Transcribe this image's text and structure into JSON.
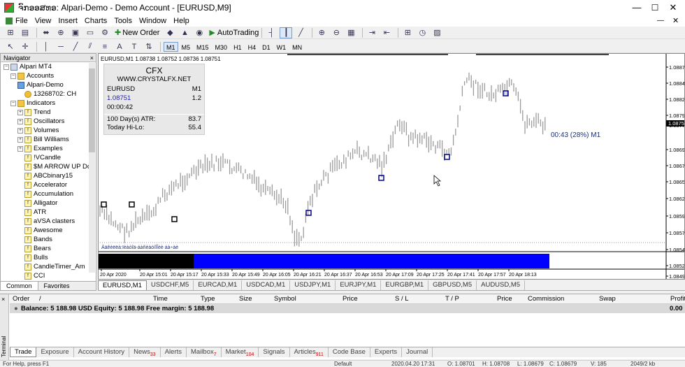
{
  "window": {
    "title": "ຈົກອອສທອ: Alpari-Demo - Demo Account - [EURUSD,M9]",
    "minimize": "—",
    "maximize": "☐",
    "close": "✕"
  },
  "menu": [
    "File",
    "View",
    "Insert",
    "Charts",
    "Tools",
    "Window",
    "Help"
  ],
  "toolbar": {
    "new_order": "New Order",
    "autotrading": "AutoTrading",
    "timeframes": [
      "M1",
      "M5",
      "M15",
      "M30",
      "H1",
      "H4",
      "D1",
      "W1",
      "MN"
    ]
  },
  "navigator": {
    "title": "Navigator",
    "close": "×",
    "items": [
      {
        "label": "Alpari MT4",
        "level": 0,
        "kind": "root"
      },
      {
        "label": "Accounts",
        "level": 1,
        "kind": "folder"
      },
      {
        "label": "Alpari-Demo",
        "level": 2,
        "kind": "server"
      },
      {
        "label": "13268702: CH",
        "level": 3,
        "kind": "user"
      },
      {
        "label": "Indicators",
        "level": 1,
        "kind": "folder"
      },
      {
        "label": "Trend",
        "level": 2,
        "kind": "ind"
      },
      {
        "label": "Oscillators",
        "level": 2,
        "kind": "ind"
      },
      {
        "label": "Volumes",
        "level": 2,
        "kind": "ind"
      },
      {
        "label": "Bill Williams",
        "level": 2,
        "kind": "ind"
      },
      {
        "label": "Examples",
        "level": 2,
        "kind": "ind"
      },
      {
        "label": "!VCandle",
        "level": 2,
        "kind": "ind"
      },
      {
        "label": "$M ARROW UP Dc",
        "level": 2,
        "kind": "ind"
      },
      {
        "label": "ABCbinary15",
        "level": 2,
        "kind": "ind"
      },
      {
        "label": "Accelerator",
        "level": 2,
        "kind": "ind"
      },
      {
        "label": "Accumulation",
        "level": 2,
        "kind": "ind"
      },
      {
        "label": "Alligator",
        "level": 2,
        "kind": "ind"
      },
      {
        "label": "ATR",
        "level": 2,
        "kind": "ind"
      },
      {
        "label": "aVSA clasters",
        "level": 2,
        "kind": "ind"
      },
      {
        "label": "Awesome",
        "level": 2,
        "kind": "ind"
      },
      {
        "label": "Bands",
        "level": 2,
        "kind": "ind"
      },
      {
        "label": "Bears",
        "level": 2,
        "kind": "ind"
      },
      {
        "label": "Bulls",
        "level": 2,
        "kind": "ind"
      },
      {
        "label": "CandleTimer_Am",
        "level": 2,
        "kind": "ind"
      },
      {
        "label": "CCI",
        "level": 2,
        "kind": "ind"
      }
    ],
    "tabs": [
      "Common",
      "Favorites"
    ]
  },
  "chart": {
    "header": "EURUSD,M1  1.08738 1.08752 1.08736 1.08751",
    "info": {
      "brand": "CFX",
      "site": "WWW.CRYSTALFX.NET",
      "symbol": "EURUSD",
      "tf": "M1",
      "price": "1.08751",
      "spread": "1.2",
      "timer": "00:00:42",
      "atr_label": "100 Day(s) ATR:",
      "atr_value": "83.7",
      "hilo_label": "Today Hi-Lo:",
      "hilo_value": "55.4"
    },
    "timer_label": "00:43 (28%) M1",
    "garbled": "Àäêèëëà:ïèàòîä-áàñèàòíîÎèè áà÷àè",
    "current_price": "1.08751",
    "price_ticks": [
      "1.08870",
      "1.08845",
      "1.08820",
      "1.08795",
      "1.08775",
      "1.08751",
      "1.08695",
      "1.08670",
      "1.08650",
      "1.08625",
      "1.08595",
      "1.08570",
      "1.08545",
      "1.08520",
      "1.08495"
    ],
    "time_ticks": [
      "20 Apr 2020",
      "20 Apr 15:01",
      "20 Apr 15:17",
      "20 Apr 15:33",
      "20 Apr 15:49",
      "20 Apr 16:05",
      "20 Apr 16:21",
      "20 Apr 16:37",
      "20 Apr 16:53",
      "20 Apr 17:09",
      "20 Apr 17:25",
      "20 Apr 17:41",
      "20 Apr 17:57",
      "20 Apr 18:13"
    ],
    "tabs": [
      "EURUSD,M1",
      "USDCHF,M5",
      "EURCAD,M1",
      "USDCAD,M1",
      "USDJPY,M1",
      "EURJPY,M1",
      "EURGBP,M1",
      "GBPUSD,M5",
      "AUDUSD,M5"
    ],
    "colors": {
      "up": "#999999",
      "marker_blue": "#00008b",
      "marker_black": "#000000",
      "bar_blue": "#0000ff"
    }
  },
  "terminal": {
    "side_label": "Terminal",
    "columns": [
      "Order",
      "/",
      "Time",
      "Type",
      "Size",
      "Symbol",
      "Price",
      "S / L",
      "T / P",
      "Price",
      "Commission",
      "Swap",
      "Profit"
    ],
    "balance": "Balance: 5 188.98 USD  Equity: 5 188.98  Free margin: 5 188.98",
    "profit": "0.00",
    "tabs": [
      {
        "label": "Trade",
        "badge": ""
      },
      {
        "label": "Exposure",
        "badge": ""
      },
      {
        "label": "Account History",
        "badge": ""
      },
      {
        "label": "News",
        "badge": "33"
      },
      {
        "label": "Alerts",
        "badge": ""
      },
      {
        "label": "Mailbox",
        "badge": "7"
      },
      {
        "label": "Market",
        "badge": "104"
      },
      {
        "label": "Signals",
        "badge": ""
      },
      {
        "label": "Articles",
        "badge": "911"
      },
      {
        "label": "Code Base",
        "badge": ""
      },
      {
        "label": "Experts",
        "badge": ""
      },
      {
        "label": "Journal",
        "badge": ""
      }
    ]
  },
  "status": {
    "help": "For Help, press F1",
    "profile": "Default",
    "datetime": "2020.04.20 17:31",
    "open": "O: 1.08701",
    "high": "H: 1.08708",
    "low": "L: 1.08679",
    "close": "C: 1.08679",
    "volume": "V: 185",
    "traffic": "2049/2 kb"
  }
}
